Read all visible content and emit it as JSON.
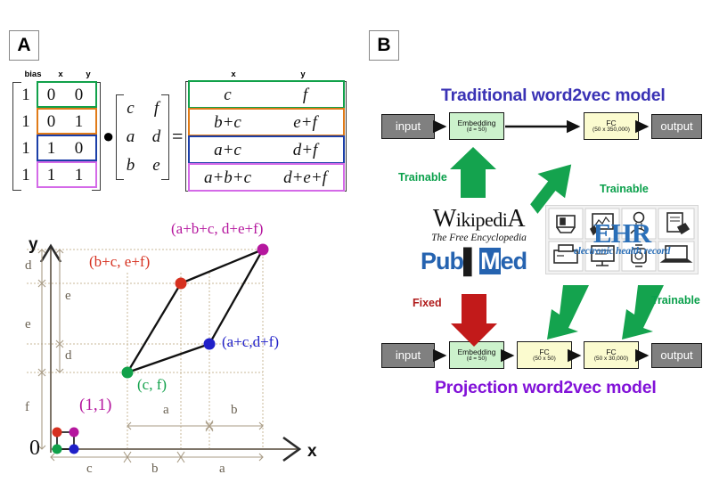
{
  "panels": {
    "a": {
      "letter": "A"
    },
    "b": {
      "letter": "B"
    }
  },
  "panel_a": {
    "matrix_equation": {
      "left_matrix": {
        "column_headers": [
          "bias",
          "x",
          "y"
        ],
        "rows": [
          {
            "values": [
              "1",
              "0",
              "0"
            ],
            "highlight_color": "#11a14a"
          },
          {
            "values": [
              "1",
              "0",
              "1"
            ],
            "highlight_color": "#e07b18"
          },
          {
            "values": [
              "1",
              "1",
              "0"
            ],
            "highlight_color": "#1c3fa8"
          },
          {
            "values": [
              "1",
              "1",
              "1"
            ],
            "highlight_color": "#d46ae8"
          }
        ]
      },
      "operator_dot": "●",
      "weight_matrix": {
        "rows": [
          [
            "c",
            "f"
          ],
          [
            "a",
            "d"
          ],
          [
            "b",
            "e"
          ]
        ]
      },
      "operator_equals": "=",
      "result_matrix": {
        "column_headers": [
          "x",
          "y"
        ],
        "rows": [
          {
            "values": [
              "c",
              "f"
            ],
            "highlight_color": "#11a14a"
          },
          {
            "values": [
              "b+c",
              "e+f"
            ],
            "highlight_color": "#e07b18"
          },
          {
            "values": [
              "a+c",
              "d+f"
            ],
            "highlight_color": "#1c3fa8"
          },
          {
            "values": [
              "a+b+c",
              "d+e+f"
            ],
            "highlight_color": "#d46ae8"
          }
        ]
      }
    },
    "plot": {
      "axis_x_label": "x",
      "axis_y_label": "y",
      "origin_label": "0",
      "unit_square_label": "(1,1)",
      "points": [
        {
          "label": "(c, f)",
          "color": "#11a14a",
          "x_expr": "c",
          "y_expr": "f"
        },
        {
          "label": "(b+c, e+f)",
          "color": "#d6301f",
          "x_expr": "b+c",
          "y_expr": "e+f"
        },
        {
          "label": "(a+c,d+f)",
          "color": "#2020c8",
          "x_expr": "a+c",
          "y_expr": "d+f"
        },
        {
          "label": "(a+b+c, d+e+f)",
          "color": "#b5179e",
          "x_expr": "a+b+c",
          "y_expr": "d+e+f"
        }
      ],
      "x_axis_segments_upper": [
        "a",
        "b"
      ],
      "x_axis_segments_lower": [
        "c",
        "b",
        "a"
      ],
      "y_axis_segments_outer": [
        "d",
        "e",
        "f"
      ],
      "y_axis_segments_inner": [
        "e",
        "d"
      ]
    }
  },
  "panel_b": {
    "top_model": {
      "title": "Traditional word2vec model",
      "title_color": "#3a32b5",
      "blocks": [
        {
          "name": "input",
          "label": "input",
          "sub": "",
          "kind": "io"
        },
        {
          "name": "embedding",
          "label": "Embedding",
          "sub": "(d = 50)",
          "kind": "emb"
        },
        {
          "name": "fc",
          "label": "FC",
          "sub": "(50 x 350,000)",
          "kind": "fc"
        },
        {
          "name": "output",
          "label": "output",
          "sub": "",
          "kind": "io"
        }
      ],
      "annotations": [
        {
          "text": "Trainable",
          "color": "#0aa04b"
        },
        {
          "text": "Trainable",
          "color": "#0aa04b"
        }
      ]
    },
    "data_sources": {
      "wikipedia": {
        "title": "WIKIPEDIA",
        "subtitle": "The Free Encyclopedia"
      },
      "pubmed": {
        "title": "PubMed"
      },
      "ehr": {
        "title": "EHR",
        "subtitle": "electronic health record"
      }
    },
    "bottom_model": {
      "title": "Projection word2vec model",
      "title_color": "#8212d8",
      "blocks": [
        {
          "name": "input",
          "label": "input",
          "sub": "",
          "kind": "io"
        },
        {
          "name": "embedding",
          "label": "Embedding",
          "sub": "(d = 50)",
          "kind": "emb"
        },
        {
          "name": "fc1",
          "label": "FC",
          "sub": "(50 x 50)",
          "kind": "fc"
        },
        {
          "name": "fc2",
          "label": "FC",
          "sub": "(50 x 30,000)",
          "kind": "fc"
        },
        {
          "name": "output",
          "label": "output",
          "sub": "",
          "kind": "io"
        }
      ],
      "annotations": [
        {
          "text": "Fixed",
          "color": "#b01c1c"
        },
        {
          "text": "Trainable",
          "color": "#0aa04b"
        }
      ]
    }
  }
}
